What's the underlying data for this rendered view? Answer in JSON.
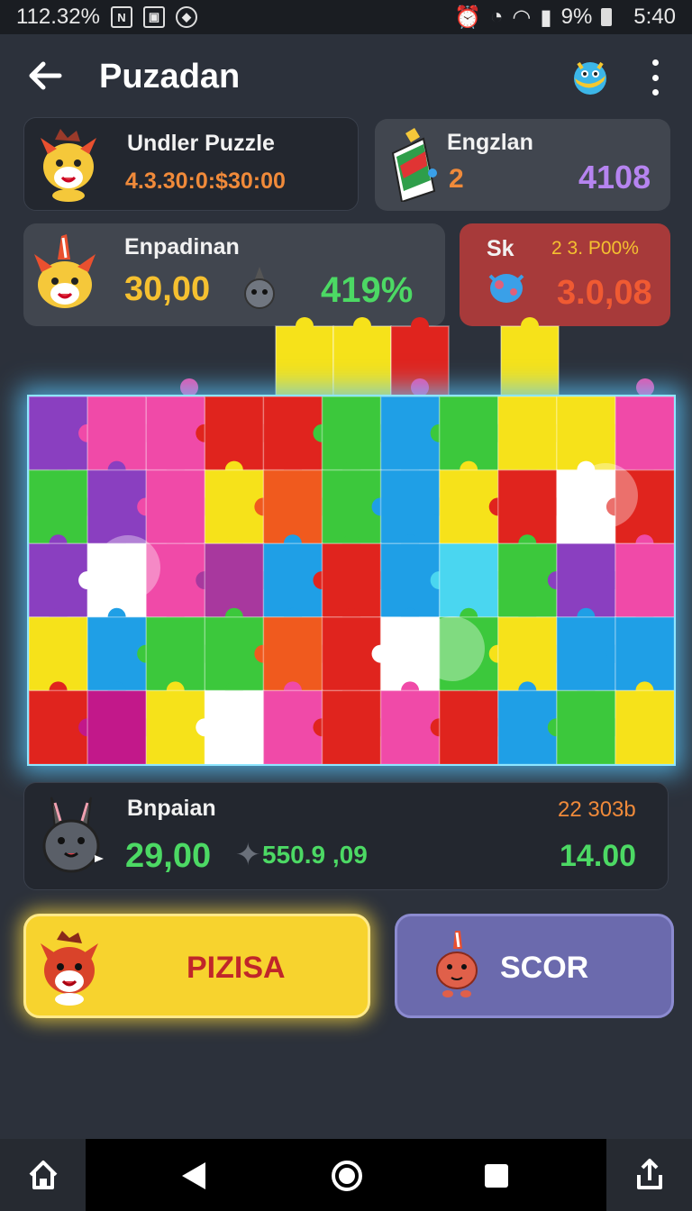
{
  "status_bar": {
    "left_text": "112.32%",
    "icons": [
      "n-icon",
      "image-icon",
      "shield-icon"
    ],
    "battery": "9%",
    "time": "5:40"
  },
  "header": {
    "title": "Puzadan"
  },
  "cards": {
    "undler": {
      "title": "Undler Puzzle",
      "value": "4.3.30:0:$30:00"
    },
    "engzlan": {
      "title": "Engzlan",
      "left_value": "2",
      "right_value": "4108"
    },
    "enpadinan": {
      "title": "Enpadinan",
      "value1": "30,00",
      "value2": "419%"
    },
    "sk": {
      "title": "Sk",
      "top_value": "2 3. P00%",
      "value": "3.0,08"
    },
    "bnpaian": {
      "title": "Bnpaian",
      "value1": "29,00",
      "value2": "550.9 ,09",
      "top_right": "22 303b",
      "value3": "14.00"
    }
  },
  "buttons": {
    "play_label": "PIZISA",
    "score_label": "SCOR"
  },
  "colors": {
    "yellow": "#f7d32e",
    "purple": "#6b6aad",
    "green": "#4cd964",
    "orange": "#f08a3a",
    "violet": "#b684f0"
  }
}
